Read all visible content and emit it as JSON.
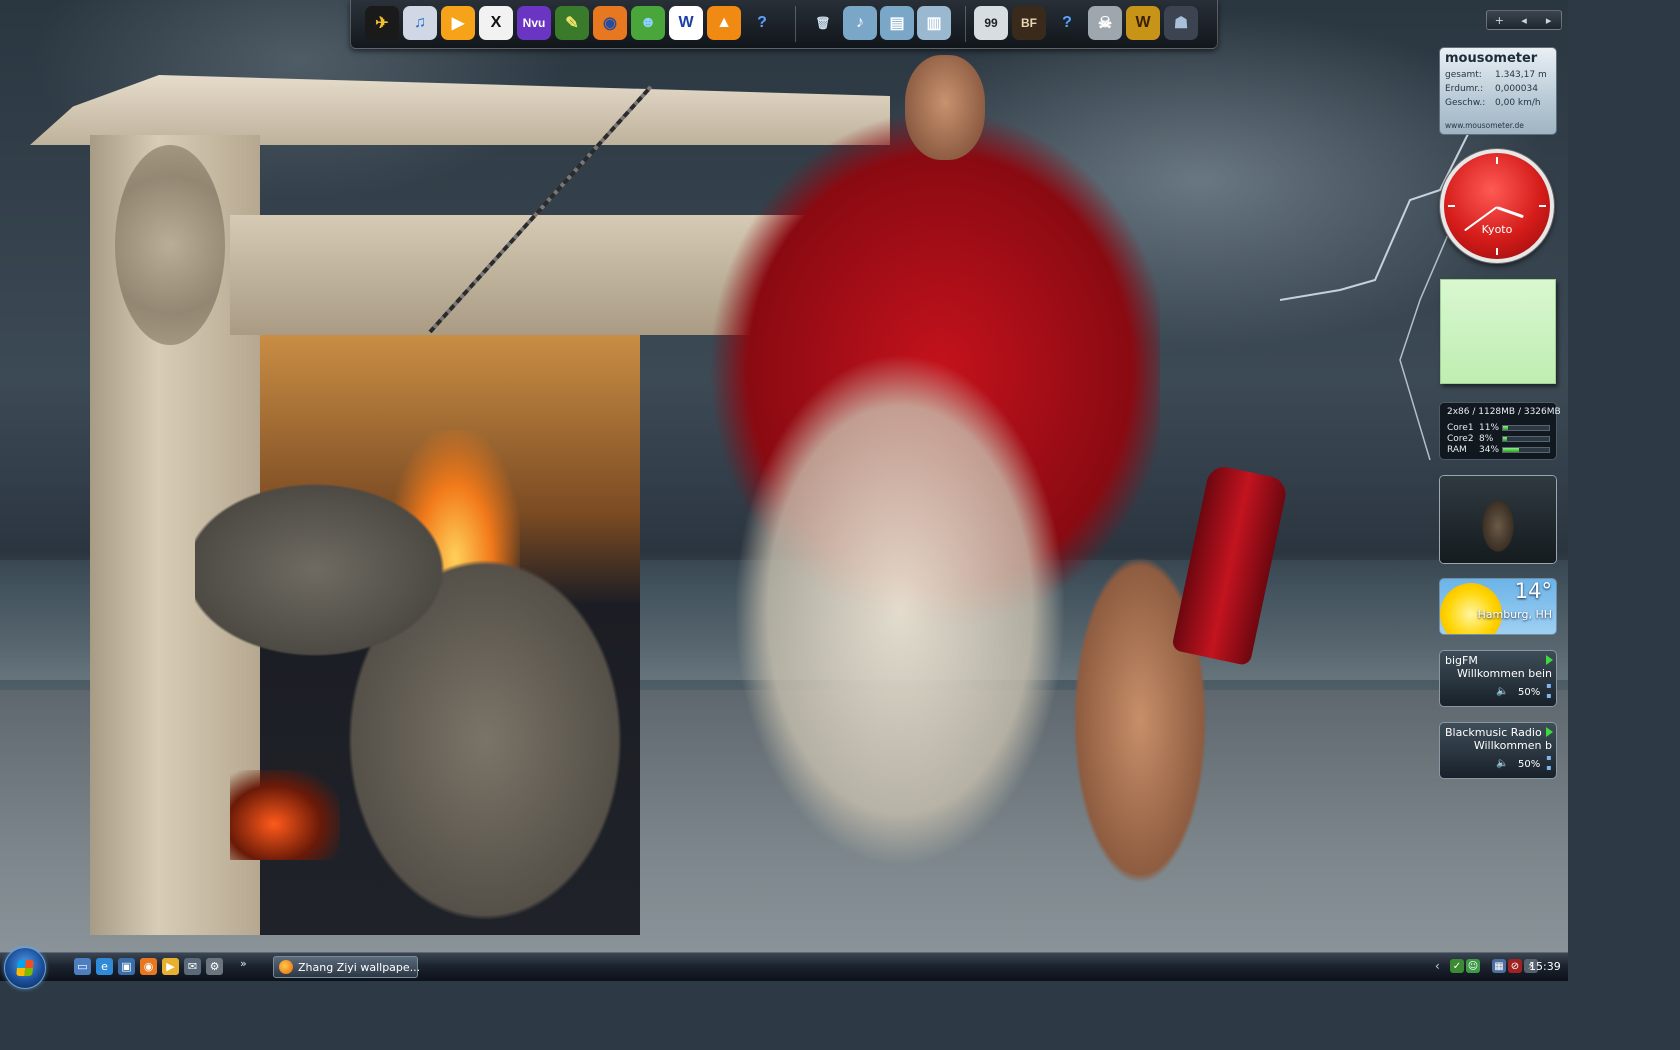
{
  "dock": {
    "left_icons": [
      {
        "name": "jet-launcher-icon",
        "glyph": "✈",
        "bg": "#1a1a1a",
        "fg": "#f4c230"
      },
      {
        "name": "itunes-icon",
        "glyph": "♫",
        "bg": "#cfd8e4",
        "fg": "#2a6cc8"
      },
      {
        "name": "media-player-icon",
        "glyph": "▶",
        "bg": "#f6a31a",
        "fg": "#ffffff"
      },
      {
        "name": "xfire-icon",
        "glyph": "X",
        "bg": "#f2f2f2",
        "fg": "#111111"
      },
      {
        "name": "nvu-icon",
        "glyph": "Nvu",
        "bg": "#6b35c4",
        "fg": "#ffffff"
      },
      {
        "name": "web-tool-icon",
        "glyph": "✎",
        "bg": "#3a7b2b",
        "fg": "#f0e46a"
      },
      {
        "name": "firefox-icon",
        "glyph": "◉",
        "bg": "#e7781f",
        "fg": "#274c9c"
      },
      {
        "name": "messenger-icon",
        "glyph": "☻",
        "bg": "#4aa63a",
        "fg": "#8fd0ff"
      },
      {
        "name": "word-icon",
        "glyph": "W",
        "bg": "#ffffff",
        "fg": "#1d3fa3"
      },
      {
        "name": "vlc-icon",
        "glyph": "▲",
        "bg": "#f08a12",
        "fg": "#ffffff"
      },
      {
        "name": "help-icon",
        "glyph": "?",
        "bg": "rgba(0,0,0,0)",
        "fg": "#5aa2ff"
      }
    ],
    "middle_icons": [
      {
        "name": "recycle-bin-icon",
        "glyph": "🗑",
        "bg": "rgba(0,0,0,0)",
        "fg": "#cfe0ee"
      },
      {
        "name": "music-folder-icon",
        "glyph": "♪",
        "bg": "#7aa6c8",
        "fg": "#ffffff"
      },
      {
        "name": "documents-folder-icon",
        "glyph": "▤",
        "bg": "#7aa6c8",
        "fg": "#ffffff"
      },
      {
        "name": "files-folder-icon",
        "glyph": "▥",
        "bg": "#9ab8cf",
        "fg": "#ffffff"
      }
    ],
    "right_icons": [
      {
        "name": "99-monitor-icon",
        "glyph": "99",
        "bg": "#d8dde2",
        "fg": "#222222"
      },
      {
        "name": "battlefield-icon",
        "glyph": "BF",
        "bg": "#3a2a1c",
        "fg": "#e9d7b2"
      },
      {
        "name": "help-icon-2",
        "glyph": "?",
        "bg": "rgba(0,0,0,0)",
        "fg": "#5aa2ff"
      },
      {
        "name": "crysis-icon",
        "glyph": "☠",
        "bg": "#9ea7ad",
        "fg": "#ffffff"
      },
      {
        "name": "warcraft-icon",
        "glyph": "W",
        "bg": "#c89418",
        "fg": "#3b2000"
      },
      {
        "name": "warcraft-hero-icon",
        "glyph": "☗",
        "bg": "#3b4450",
        "fg": "#a8c0d8"
      }
    ]
  },
  "sidebar_controls": {
    "add": "+",
    "prev": "◂",
    "next": "▸"
  },
  "mousometer": {
    "title": "mousometer",
    "rows": [
      {
        "label": "gesamt:",
        "value": "1.343,17 m"
      },
      {
        "label": "Erdumr.:",
        "value": "0,000034"
      },
      {
        "label": "Geschw.:",
        "value": "0,00 km/h"
      }
    ],
    "url": "www.mousometer.de"
  },
  "clock": {
    "city": "Kyoto",
    "hour": 3,
    "minute": 39
  },
  "cpu": {
    "header": "2x86 / 1128MB / 3326MB",
    "rows": [
      {
        "label": "Core1",
        "pct": "11%",
        "fill": 0.11
      },
      {
        "label": "Core2",
        "pct": "8%",
        "fill": 0.08
      },
      {
        "label": "RAM",
        "pct": "34%",
        "fill": 0.34
      }
    ]
  },
  "weather": {
    "temp": "14°",
    "location": "Hamburg, HH"
  },
  "radios": [
    {
      "station": "bigFM",
      "message": "Willkommen bein",
      "volume": "50%"
    },
    {
      "station": "Blackmusic Radio",
      "message": "Willkommen b",
      "volume": "50%"
    }
  ],
  "taskbar": {
    "quick_launch": [
      {
        "name": "show-desktop-icon",
        "glyph": "▭",
        "bg": "#4d7fc0"
      },
      {
        "name": "internet-explorer-icon",
        "glyph": "e",
        "bg": "#2f8ad8"
      },
      {
        "name": "switch-windows-icon",
        "glyph": "▣",
        "bg": "#3b6ea6"
      },
      {
        "name": "firefox-quick-icon",
        "glyph": "◉",
        "bg": "#e7781f"
      },
      {
        "name": "folder-quick-icon",
        "glyph": "▶",
        "bg": "#e8b030"
      },
      {
        "name": "mail-quick-icon",
        "glyph": "✉",
        "bg": "#5a6a7a"
      },
      {
        "name": "settings-quick-icon",
        "glyph": "⚙",
        "bg": "#6a7580"
      }
    ],
    "more": "»",
    "task_button": "Zhang Ziyi wallpape...",
    "tray_expand": "‹",
    "tray_icons": [
      {
        "name": "security-tray-icon",
        "glyph": "✓",
        "bg": "#3c8a32"
      },
      {
        "name": "network-people-tray-icon",
        "glyph": "☺",
        "bg": "#3e9a44"
      },
      {
        "name": "network-tray-icon",
        "glyph": "▦",
        "bg": "#4c6fa0"
      },
      {
        "name": "volume-muted-tray-icon",
        "glyph": "⊘",
        "bg": "#a02222"
      },
      {
        "name": "power-tray-icon",
        "glyph": "⚡",
        "bg": "#56626e"
      }
    ],
    "time": "15:39"
  }
}
